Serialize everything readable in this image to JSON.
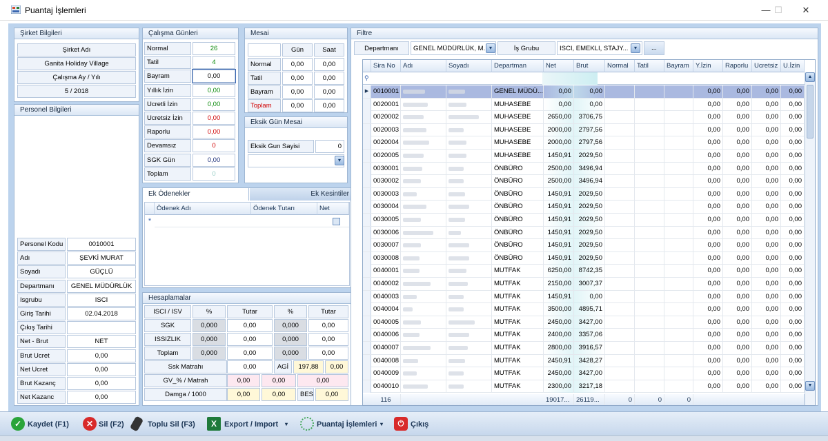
{
  "window": {
    "title": "Puantaj İşlemleri",
    "minimize": "—",
    "maximize": "☐",
    "close": "✕"
  },
  "sirket": {
    "header": "Şirket Bilgileri",
    "label_adi": "Şirket Adı",
    "adi": "Ganita Holiday Village",
    "label_ay": "Çalışma Ay / Yılı",
    "ay": "5 / 2018"
  },
  "personel": {
    "header": "Personel Bilgileri",
    "fields": [
      {
        "label": "Personel Kodu",
        "value": "0010001"
      },
      {
        "label": "Adı",
        "value": "ŞEVKİ MURAT"
      },
      {
        "label": "Soyadı",
        "value": "GÜÇLÜ"
      },
      {
        "label": "Departmanı",
        "value": "GENEL MÜDÜRLÜK"
      },
      {
        "label": "Isgrubu",
        "value": "ISCI"
      },
      {
        "label": "Giriş Tarihi",
        "value": "02.04.2018"
      },
      {
        "label": "Çıkış Tarihi",
        "value": ""
      },
      {
        "label": "Net - Brut",
        "value": "NET"
      },
      {
        "label": "Brut Ucret",
        "value": "0,00"
      },
      {
        "label": "Net Ucret",
        "value": "0,00"
      },
      {
        "label": "Brut Kazanç",
        "value": "0,00"
      },
      {
        "label": "Net Kazanc",
        "value": "0,00"
      }
    ]
  },
  "calisma": {
    "header": "Çalışma Günleri",
    "rows": [
      {
        "label": "Normal",
        "value": "26",
        "color": "#0a8a0a"
      },
      {
        "label": "Tatil",
        "value": "4",
        "color": "#0a8a0a"
      },
      {
        "label": "Bayram",
        "value": "0,00",
        "color": "#000000"
      },
      {
        "label": "Yıllık İzin",
        "value": "0,00",
        "color": "#0a8a0a"
      },
      {
        "label": "Ucretli İzin",
        "value": "0,00",
        "color": "#0a8a0a"
      },
      {
        "label": "Ucretsiz İzin",
        "value": "0,00",
        "color": "#d00000"
      },
      {
        "label": "Raporlu",
        "value": "0,00",
        "color": "#d00000"
      },
      {
        "label": "Devamsız",
        "value": "0",
        "color": "#d00000"
      },
      {
        "label": "SGK Gün",
        "value": "0,00",
        "color": "#1c2f7a"
      },
      {
        "label": "Toplam",
        "value": "0",
        "color": "#9ad0c8"
      }
    ]
  },
  "mesai": {
    "header": "Mesai",
    "col_gun": "Gün",
    "col_saat": "Saat",
    "rows": [
      {
        "label": "Normal",
        "gun": "0,00",
        "saat": "0,00"
      },
      {
        "label": "Tatil",
        "gun": "0,00",
        "saat": "0,00"
      },
      {
        "label": "Bayram",
        "gun": "0,00",
        "saat": "0,00"
      },
      {
        "label": "Toplam",
        "gun": "0,00",
        "saat": "0,00"
      }
    ]
  },
  "eksik": {
    "header": "Eksik Gün Mesai",
    "label": "Eksik Gun Sayisi",
    "value": "0",
    "select": ""
  },
  "odemeler": {
    "tab1": "Ek Ödenekler",
    "tab2": "Ek Kesintiler",
    "cols": [
      "Ödenek Adı",
      "Ödenek Tutarı",
      "Net"
    ],
    "new_row_marker": "*"
  },
  "hesap": {
    "header": "Hesaplamalar",
    "cols": [
      "ISCI / ISV",
      "%",
      "Tutar",
      "%",
      "Tutar"
    ],
    "rows": [
      {
        "label": "SGK",
        "p1": "0,000",
        "t1": "0,00",
        "p2": "0,000",
        "t2": "0,00"
      },
      {
        "label": "ISSIZLIK",
        "p1": "0,000",
        "t1": "0,00",
        "p2": "0,000",
        "t2": "0,00"
      },
      {
        "label": "Toplam",
        "p1": "0,000",
        "t1": "0,00",
        "p2": "0,000",
        "t2": "0,00"
      }
    ],
    "ssk_label": "Ssk Matrahı",
    "ssk": "0,00",
    "agi_label": "AGİ",
    "agi": "197,88",
    "agi2": "0,00",
    "gv_label": "GV_% / Matrah",
    "gv1": "0,00",
    "gv2": "0,00",
    "gv3": "0,00",
    "damga_label": "Damga / 1000",
    "damga1": "0,00",
    "damga2": "0,00",
    "bes_label": "BES",
    "bes": "0,00"
  },
  "filtre": {
    "header": "Filtre",
    "dep_label": "Departmanı",
    "dep_value": "GENEL MÜDÜRLÜK, M...",
    "is_label": "İş Grubu",
    "is_value": "ISCI, EMEKLI, STAJY...",
    "more": "..."
  },
  "grid": {
    "columns": [
      "Sira No",
      "Adı",
      "Soyadı",
      "Departman",
      "Net",
      "Brut",
      "Normal",
      "Tatil",
      "Bayram",
      "Y.İzin",
      "Raporlu",
      "Ucretsiz",
      "U.İzin"
    ],
    "rows": [
      {
        "no": "0010001",
        "dep": "GENEL MÜDÜ...",
        "net": "0,00",
        "brut": "0,00"
      },
      {
        "no": "0020001",
        "dep": "MUHASEBE",
        "net": "0,00",
        "brut": "0,00"
      },
      {
        "no": "0020002",
        "dep": "MUHASEBE",
        "net": "2650,00",
        "brut": "3706,75"
      },
      {
        "no": "0020003",
        "dep": "MUHASEBE",
        "net": "2000,00",
        "brut": "2797,56"
      },
      {
        "no": "0020004",
        "dep": "MUHASEBE",
        "net": "2000,00",
        "brut": "2797,56"
      },
      {
        "no": "0020005",
        "dep": "MUHASEBE",
        "net": "1450,91",
        "brut": "2029,50"
      },
      {
        "no": "0030001",
        "dep": "ÖNBÜRO",
        "net": "2500,00",
        "brut": "3496,94"
      },
      {
        "no": "0030002",
        "dep": "ÖNBÜRO",
        "net": "2500,00",
        "brut": "3496,94"
      },
      {
        "no": "0030003",
        "dep": "ÖNBÜRO",
        "net": "1450,91",
        "brut": "2029,50"
      },
      {
        "no": "0030004",
        "dep": "ÖNBÜRO",
        "net": "1450,91",
        "brut": "2029,50"
      },
      {
        "no": "0030005",
        "dep": "ÖNBÜRO",
        "net": "1450,91",
        "brut": "2029,50"
      },
      {
        "no": "0030006",
        "dep": "ÖNBÜRO",
        "net": "1450,91",
        "brut": "2029,50"
      },
      {
        "no": "0030007",
        "dep": "ÖNBÜRO",
        "net": "1450,91",
        "brut": "2029,50"
      },
      {
        "no": "0030008",
        "dep": "ÖNBÜRO",
        "net": "1450,91",
        "brut": "2029,50"
      },
      {
        "no": "0040001",
        "dep": "MUTFAK",
        "net": "6250,00",
        "brut": "8742,35"
      },
      {
        "no": "0040002",
        "dep": "MUTFAK",
        "net": "2150,00",
        "brut": "3007,37"
      },
      {
        "no": "0040003",
        "dep": "MUTFAK",
        "net": "1450,91",
        "brut": "0,00"
      },
      {
        "no": "0040004",
        "dep": "MUTFAK",
        "net": "3500,00",
        "brut": "4895,71"
      },
      {
        "no": "0040005",
        "dep": "MUTFAK",
        "net": "2450,00",
        "brut": "3427,00"
      },
      {
        "no": "0040006",
        "dep": "MUTFAK",
        "net": "2400,00",
        "brut": "3357,06"
      },
      {
        "no": "0040007",
        "dep": "MUTFAK",
        "net": "2800,00",
        "brut": "3916,57"
      },
      {
        "no": "0040008",
        "dep": "MUTFAK",
        "net": "2450,91",
        "brut": "3428,27"
      },
      {
        "no": "0040009",
        "dep": "MUTFAK",
        "net": "2450,00",
        "brut": "3427,00"
      },
      {
        "no": "0040010",
        "dep": "MUTFAK",
        "net": "2300,00",
        "brut": "3217,18"
      }
    ],
    "zero": "0,00",
    "footer": {
      "count": "116",
      "net": "19017...",
      "brut": "26119...",
      "normal": "0",
      "tatil": "0",
      "bayram": "0"
    }
  },
  "toolbar": {
    "kaydet": "Kaydet (F1)",
    "sil": "Sil (F2)",
    "toplu": "Toplu Sil (F3)",
    "export": "Export / Import",
    "puantaj": "Puantaj İşlemleri",
    "cikis": "Çıkış",
    "dropdown_glyph": "▾"
  }
}
